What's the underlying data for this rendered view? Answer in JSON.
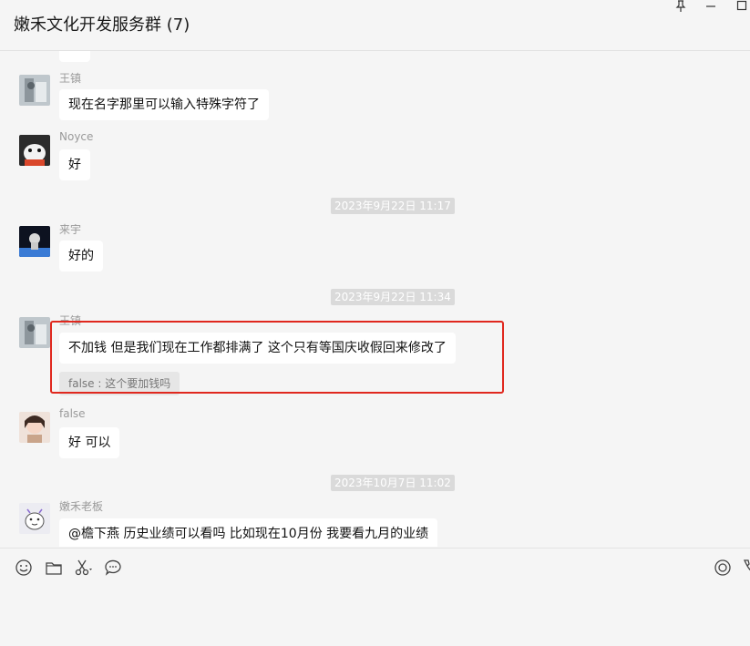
{
  "window": {
    "title": "嫩禾文化开发服务群 (7)",
    "controls": [
      "pin-icon",
      "minimize-icon",
      "maximize-icon"
    ]
  },
  "messages": [
    {
      "sender": "王镇",
      "text": "现在名字那里可以输入特殊字符了",
      "avatar": "avatar-wangzhen"
    },
    {
      "sender": "Noyce",
      "text": "好",
      "avatar": "avatar-noyce"
    },
    {
      "timestamp": "2023年9月22日 11:17"
    },
    {
      "sender": "来宇",
      "text": "好的",
      "avatar": "avatar-laiyu"
    },
    {
      "timestamp": "2023年9月22日 11:34"
    },
    {
      "sender": "王镇",
      "text": "不加钱    但是我们现在工作都排满了  这个只有等国庆收假回来修改了",
      "quote": "false : 这个要加钱吗",
      "avatar": "avatar-wangzhen",
      "highlighted": true
    },
    {
      "sender": "false",
      "text": "好 可以",
      "avatar": "avatar-false"
    },
    {
      "timestamp": "2023年10月7日 11:02"
    },
    {
      "sender": "嫩禾老板",
      "text": "@檐下燕      历史业绩可以看吗    比如现在10月份 我要看九月的业绩",
      "avatar": "avatar-boss"
    }
  ],
  "toolbar": {
    "left": [
      "emoji-icon",
      "folder-icon",
      "scissors-icon",
      "chat-bubble-icon"
    ],
    "right": [
      "live-icon",
      "call-icon"
    ]
  },
  "colors": {
    "highlight_border": "#e0281e",
    "bubble": "#ffffff",
    "background": "#f5f5f5",
    "timestamp_bg": "#dadada"
  }
}
